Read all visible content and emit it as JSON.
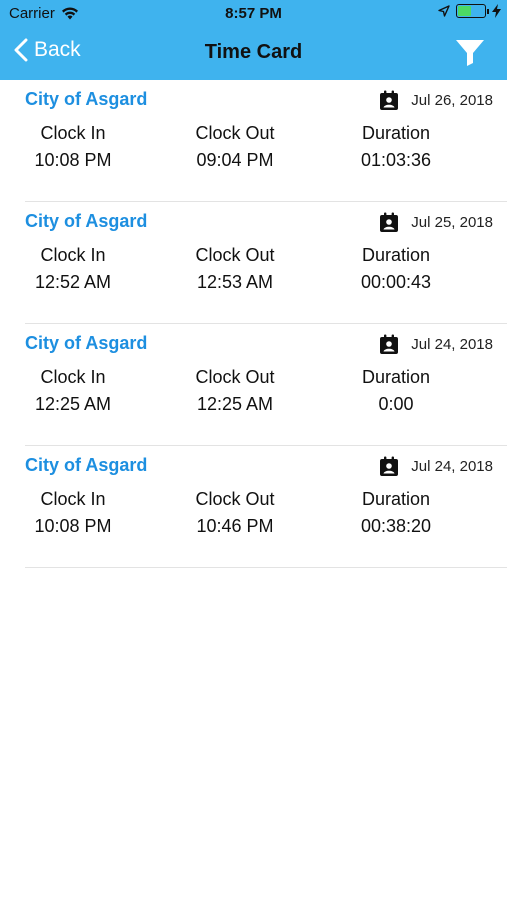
{
  "status": {
    "carrier": "Carrier",
    "time": "8:57 PM",
    "battery_level": 0.55
  },
  "nav": {
    "back_label": "Back",
    "title": "Time Card"
  },
  "labels": {
    "clock_in": "Clock In",
    "clock_out": "Clock Out",
    "duration": "Duration"
  },
  "entries": [
    {
      "org": "City of Asgard",
      "date": "Jul 26, 2018",
      "clock_in": "10:08 PM",
      "clock_out": "09:04 PM",
      "duration": "01:03:36"
    },
    {
      "org": "City of Asgard",
      "date": "Jul 25, 2018",
      "clock_in": "12:52 AM",
      "clock_out": "12:53 AM",
      "duration": "00:00:43"
    },
    {
      "org": "City of Asgard",
      "date": "Jul 24, 2018",
      "clock_in": "12:25 AM",
      "clock_out": "12:25 AM",
      "duration": "0:00"
    },
    {
      "org": "City of Asgard",
      "date": "Jul 24, 2018",
      "clock_in": "10:08 PM",
      "clock_out": "10:46 PM",
      "duration": "00:38:20"
    }
  ],
  "colors": {
    "header_bg": "#3fb3ee",
    "org_text": "#1d8fe0",
    "battery": "#4cd964"
  },
  "icons": {
    "back": "chevron-left-icon",
    "filter": "filter-icon",
    "calendar": "calendar-contact-icon",
    "wifi": "wifi-icon",
    "location": "location-arrow-icon",
    "charging": "bolt-icon"
  }
}
